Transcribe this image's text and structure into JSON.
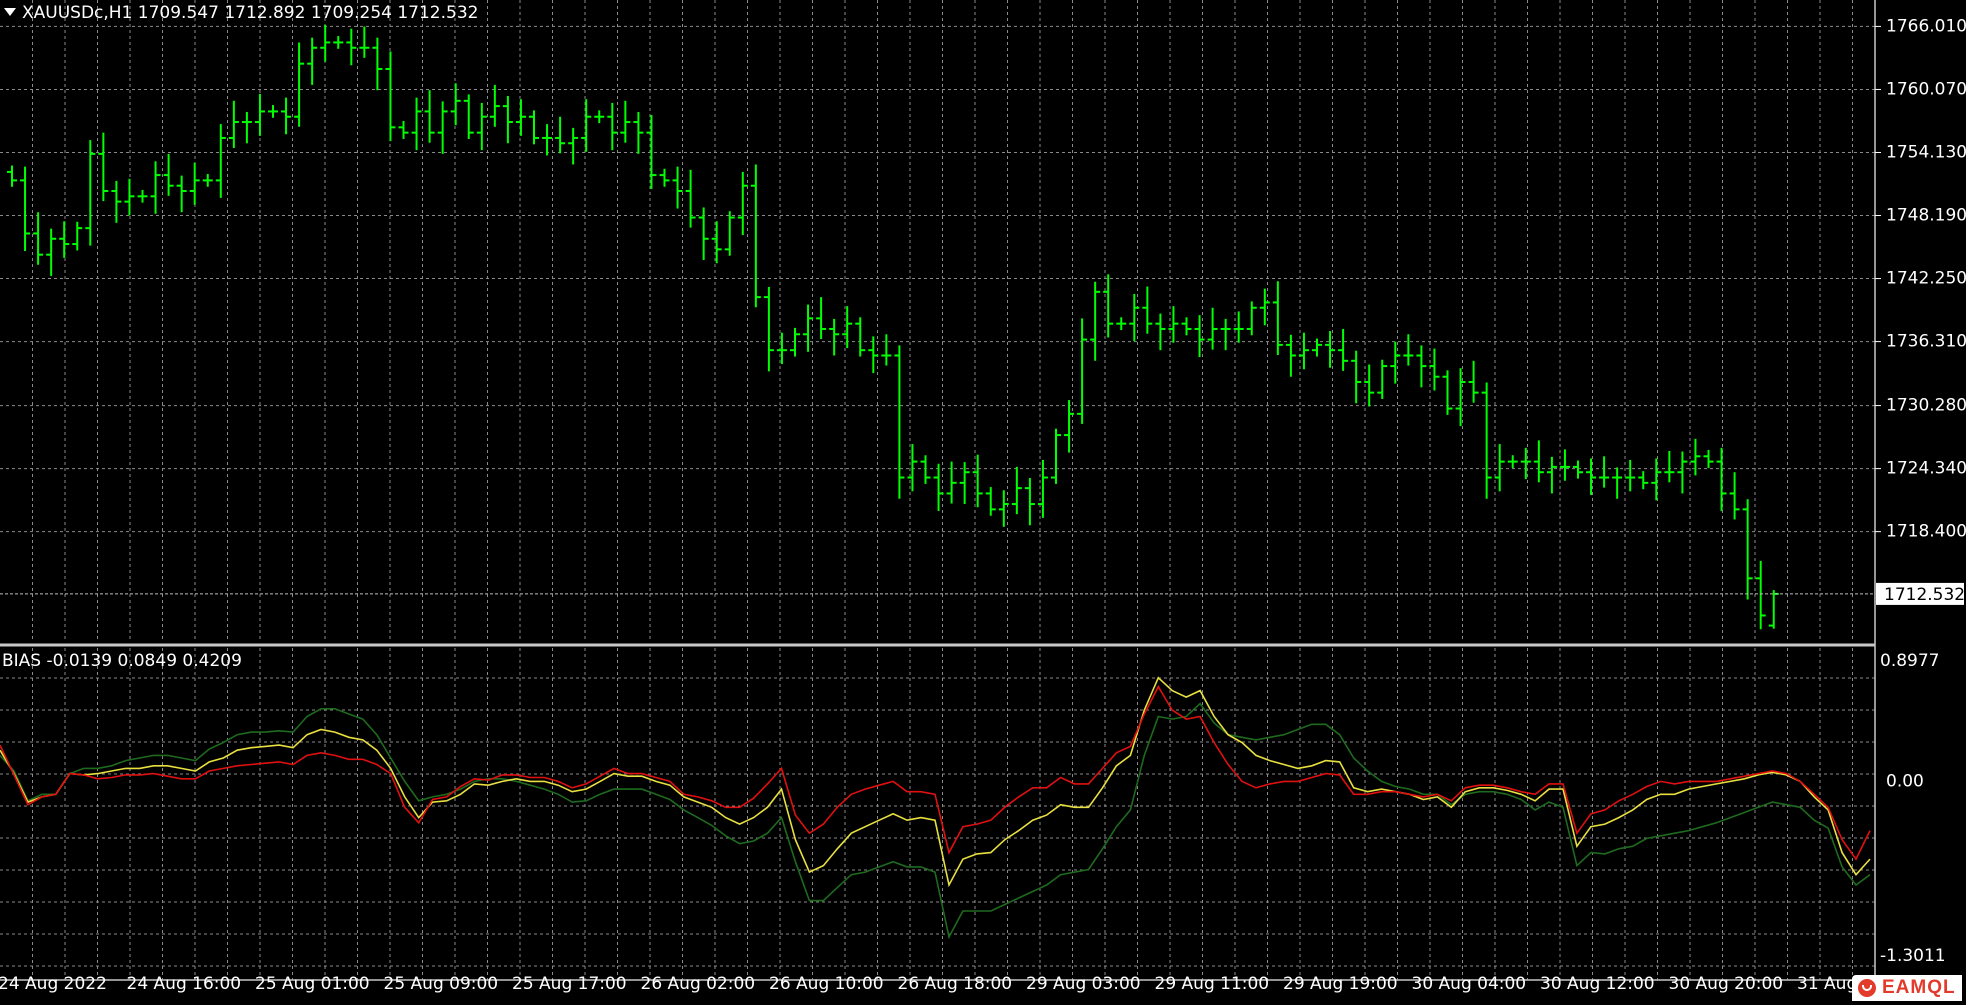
{
  "window": {
    "symbol_info": "XAUUSDc,H1  1709.547 1712.892 1709.254 1712.532",
    "indicator_info": "BIAS -0.0139 0.0849 0.4209"
  },
  "logo": {
    "text": "EAMQL",
    "icon": "eamql-logo-icon"
  },
  "colors": {
    "background": "#000000",
    "grid": "#8a8a8a",
    "bars": "#00ff00",
    "bias_fast": "#e01010",
    "bias_mid": "#e8e040",
    "bias_slow": "#1e6a1e",
    "text": "#ffffff",
    "separator": "#c8c8c8"
  },
  "chart_data": [
    {
      "type": "ohlc",
      "symbol": "XAUUSDc",
      "timeframe": "H1",
      "ylim": [
        1708.0,
        1768.5
      ],
      "y_ticks": [
        "1766.010",
        "1760.070",
        "1754.130",
        "1748.190",
        "1742.250",
        "1736.310",
        "1730.280",
        "1724.340",
        "1718.400"
      ],
      "current_price": "1712.532",
      "last_bar": {
        "open": 1709.547,
        "high": 1712.892,
        "low": 1709.254,
        "close": 1712.532
      },
      "x_labels": [
        "24 Aug 2022",
        "24 Aug 16:00",
        "25 Aug 01:00",
        "25 Aug 09:00",
        "25 Aug 17:00",
        "26 Aug 02:00",
        "26 Aug 10:00",
        "26 Aug 18:00",
        "29 Aug 03:00",
        "29 Aug 11:00",
        "29 Aug 19:00",
        "30 Aug 04:00",
        "30 Aug 12:00",
        "30 Aug 20:00",
        "31 Aug 05:00"
      ],
      "grid": true,
      "closes": [
        1751.5,
        1746.5,
        1744.5,
        1746.0,
        1745.5,
        1747.0,
        1754.0,
        1750.5,
        1749.5,
        1750.0,
        1750.0,
        1752.0,
        1751.0,
        1750.5,
        1751.5,
        1751.5,
        1755.5,
        1757.0,
        1757.0,
        1758.0,
        1758.0,
        1757.5,
        1762.5,
        1764.0,
        1764.5,
        1764.5,
        1764.0,
        1764.0,
        1762.0,
        1756.5,
        1756.0,
        1758.0,
        1756.0,
        1758.0,
        1759.0,
        1756.0,
        1757.5,
        1758.5,
        1757.0,
        1757.5,
        1755.5,
        1755.5,
        1755.0,
        1755.5,
        1757.5,
        1757.5,
        1756.0,
        1757.0,
        1756.0,
        1752.0,
        1751.5,
        1750.5,
        1748.0,
        1746.0,
        1745.0,
        1748.0,
        1751.0,
        1740.5,
        1735.5,
        1735.5,
        1737.0,
        1738.5,
        1737.5,
        1737.0,
        1738.0,
        1735.5,
        1735.0,
        1735.0,
        1723.5,
        1725.0,
        1723.5,
        1722.0,
        1723.0,
        1724.0,
        1722.0,
        1720.5,
        1721.0,
        1722.5,
        1721.0,
        1723.5,
        1727.5,
        1729.5,
        1736.5,
        1741.0,
        1738.0,
        1738.0,
        1739.5,
        1738.0,
        1737.5,
        1738.0,
        1737.5,
        1736.5,
        1737.5,
        1737.5,
        1737.5,
        1739.5,
        1740.0,
        1736.0,
        1735.0,
        1735.5,
        1736.0,
        1735.5,
        1734.5,
        1732.5,
        1731.5,
        1734.0,
        1735.0,
        1735.0,
        1734.0,
        1733.0,
        1730.0,
        1732.5,
        1731.5,
        1723.5,
        1725.0,
        1725.0,
        1725.0,
        1724.0,
        1724.5,
        1724.5,
        1724.0,
        1723.5,
        1723.5,
        1723.5,
        1723.5,
        1723.0,
        1724.0,
        1724.0,
        1725.0,
        1725.5,
        1725.0,
        1722.0,
        1720.5,
        1714.0,
        1710.5,
        1712.532
      ]
    },
    {
      "type": "line",
      "indicator": "BIAS",
      "ylim": [
        -1.3011,
        0.8977
      ],
      "y_ticks": [
        "0.8977",
        "0.00",
        "-1.3011"
      ],
      "last_values": [
        -0.0139,
        0.0849,
        0.4209
      ],
      "series": [
        {
          "color": "#e01010",
          "values": [
            0.28,
            0.05,
            -0.18,
            -0.12,
            -0.1,
            0.06,
            0.05,
            0.02,
            0.03,
            0.05,
            0.05,
            0.06,
            0.04,
            0.02,
            0.02,
            0.08,
            0.1,
            0.12,
            0.13,
            0.14,
            0.15,
            0.13,
            0.2,
            0.22,
            0.2,
            0.17,
            0.17,
            0.13,
            0.06,
            -0.2,
            -0.32,
            -0.14,
            -0.12,
            -0.04,
            0.02,
            0.01,
            0.05,
            0.05,
            0.03,
            0.03,
            0.0,
            -0.05,
            -0.02,
            0.04,
            0.1,
            0.06,
            0.06,
            0.03,
            0.0,
            -0.1,
            -0.12,
            -0.15,
            -0.2,
            -0.2,
            -0.13,
            -0.02,
            0.1,
            -0.26,
            -0.4,
            -0.33,
            -0.2,
            -0.1,
            -0.06,
            -0.03,
            0.0,
            -0.08,
            -0.08,
            -0.1,
            -0.55,
            -0.35,
            -0.33,
            -0.3,
            -0.2,
            -0.12,
            -0.05,
            -0.05,
            0.03,
            -0.02,
            -0.02,
            0.1,
            0.22,
            0.27,
            0.52,
            0.73,
            0.55,
            0.48,
            0.5,
            0.3,
            0.13,
            0.0,
            -0.05,
            -0.02,
            0.0,
            0.0,
            0.03,
            0.06,
            0.05,
            -0.1,
            -0.1,
            -0.08,
            -0.08,
            -0.1,
            -0.12,
            -0.1,
            -0.15,
            -0.05,
            -0.03,
            -0.03,
            -0.05,
            -0.08,
            -0.1,
            -0.02,
            -0.02,
            -0.4,
            -0.25,
            -0.22,
            -0.15,
            -0.1,
            -0.04,
            0.0,
            -0.02,
            0.0,
            0.0,
            0.0,
            0.02,
            0.04,
            0.06,
            0.08,
            0.06,
            0.0,
            -0.1,
            -0.2,
            -0.45,
            -0.6,
            -0.38
          ]
        },
        {
          "color": "#e8e040",
          "values": [
            0.24,
            0.06,
            -0.16,
            -0.12,
            -0.1,
            0.06,
            0.05,
            0.06,
            0.08,
            0.1,
            0.1,
            0.12,
            0.12,
            0.1,
            0.08,
            0.15,
            0.18,
            0.24,
            0.26,
            0.27,
            0.28,
            0.26,
            0.36,
            0.4,
            0.38,
            0.34,
            0.32,
            0.24,
            0.1,
            -0.12,
            -0.28,
            -0.16,
            -0.15,
            -0.1,
            -0.02,
            -0.03,
            0.0,
            0.02,
            0.0,
            0.0,
            -0.03,
            -0.08,
            -0.06,
            0.0,
            0.06,
            0.04,
            0.04,
            0.0,
            -0.03,
            -0.12,
            -0.16,
            -0.2,
            -0.28,
            -0.33,
            -0.28,
            -0.2,
            -0.06,
            -0.45,
            -0.7,
            -0.65,
            -0.52,
            -0.4,
            -0.35,
            -0.3,
            -0.25,
            -0.3,
            -0.28,
            -0.3,
            -0.8,
            -0.6,
            -0.56,
            -0.55,
            -0.45,
            -0.38,
            -0.3,
            -0.26,
            -0.18,
            -0.2,
            -0.2,
            -0.05,
            0.12,
            0.2,
            0.55,
            0.8,
            0.7,
            0.65,
            0.7,
            0.5,
            0.36,
            0.3,
            0.2,
            0.16,
            0.13,
            0.1,
            0.12,
            0.16,
            0.15,
            -0.05,
            -0.08,
            -0.06,
            -0.08,
            -0.1,
            -0.14,
            -0.12,
            -0.2,
            -0.08,
            -0.05,
            -0.05,
            -0.07,
            -0.1,
            -0.15,
            -0.06,
            -0.06,
            -0.5,
            -0.35,
            -0.33,
            -0.28,
            -0.22,
            -0.14,
            -0.1,
            -0.1,
            -0.06,
            -0.04,
            -0.02,
            0.0,
            0.02,
            0.05,
            0.07,
            0.05,
            0.0,
            -0.12,
            -0.22,
            -0.55,
            -0.72,
            -0.6
          ]
        },
        {
          "color": "#1e6a1e",
          "values": [
            0.2,
            0.08,
            -0.15,
            -0.1,
            -0.1,
            0.06,
            0.1,
            0.1,
            0.12,
            0.16,
            0.18,
            0.2,
            0.2,
            0.18,
            0.16,
            0.25,
            0.3,
            0.36,
            0.38,
            0.38,
            0.39,
            0.38,
            0.5,
            0.56,
            0.56,
            0.52,
            0.48,
            0.36,
            0.18,
            0.0,
            -0.15,
            -0.12,
            -0.1,
            -0.06,
            0.0,
            0.02,
            0.02,
            0.0,
            -0.03,
            -0.06,
            -0.1,
            -0.16,
            -0.15,
            -0.1,
            -0.06,
            -0.06,
            -0.06,
            -0.1,
            -0.14,
            -0.22,
            -0.28,
            -0.34,
            -0.42,
            -0.48,
            -0.46,
            -0.4,
            -0.28,
            -0.62,
            -0.92,
            -0.92,
            -0.82,
            -0.72,
            -0.7,
            -0.66,
            -0.62,
            -0.66,
            -0.66,
            -0.7,
            -1.2,
            -1.0,
            -1.0,
            -1.0,
            -0.95,
            -0.9,
            -0.85,
            -0.8,
            -0.72,
            -0.7,
            -0.68,
            -0.52,
            -0.35,
            -0.22,
            0.2,
            0.5,
            0.48,
            0.5,
            0.6,
            0.45,
            0.36,
            0.34,
            0.32,
            0.34,
            0.36,
            0.4,
            0.44,
            0.44,
            0.36,
            0.18,
            0.08,
            0.0,
            -0.04,
            -0.06,
            -0.1,
            -0.1,
            -0.18,
            -0.1,
            -0.08,
            -0.08,
            -0.1,
            -0.14,
            -0.22,
            -0.16,
            -0.2,
            -0.65,
            -0.55,
            -0.56,
            -0.52,
            -0.5,
            -0.44,
            -0.42,
            -0.4,
            -0.38,
            -0.35,
            -0.32,
            -0.28,
            -0.24,
            -0.2,
            -0.16,
            -0.18,
            -0.2,
            -0.3,
            -0.36,
            -0.66,
            -0.8,
            -0.72
          ]
        }
      ]
    }
  ]
}
